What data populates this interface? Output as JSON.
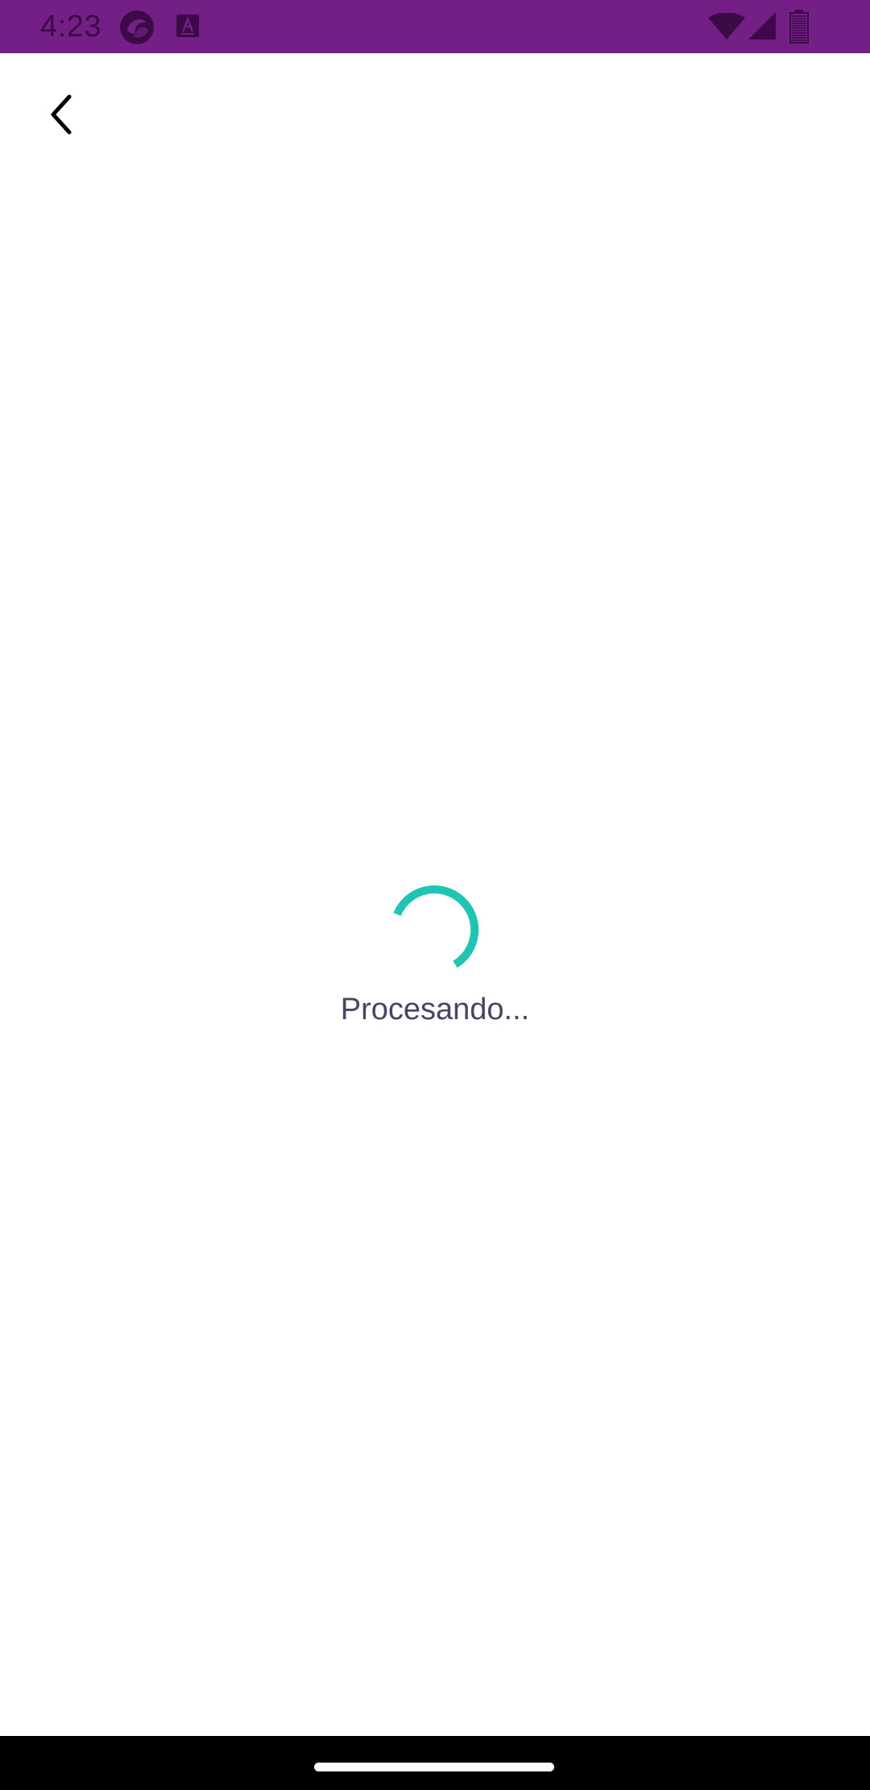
{
  "status_bar": {
    "time": "4:23",
    "background_color": "#741f85",
    "icons": [
      "app-notification-icon",
      "font-app-icon",
      "wifi-icon",
      "cell-signal-icon",
      "battery-icon"
    ]
  },
  "app_bar": {
    "back_icon": "chevron-left-icon"
  },
  "loading": {
    "message": "Procesando...",
    "spinner_color": "#1fc4b4",
    "text_color": "#4a4361"
  },
  "nav_bar": {
    "background_color": "#000000"
  }
}
